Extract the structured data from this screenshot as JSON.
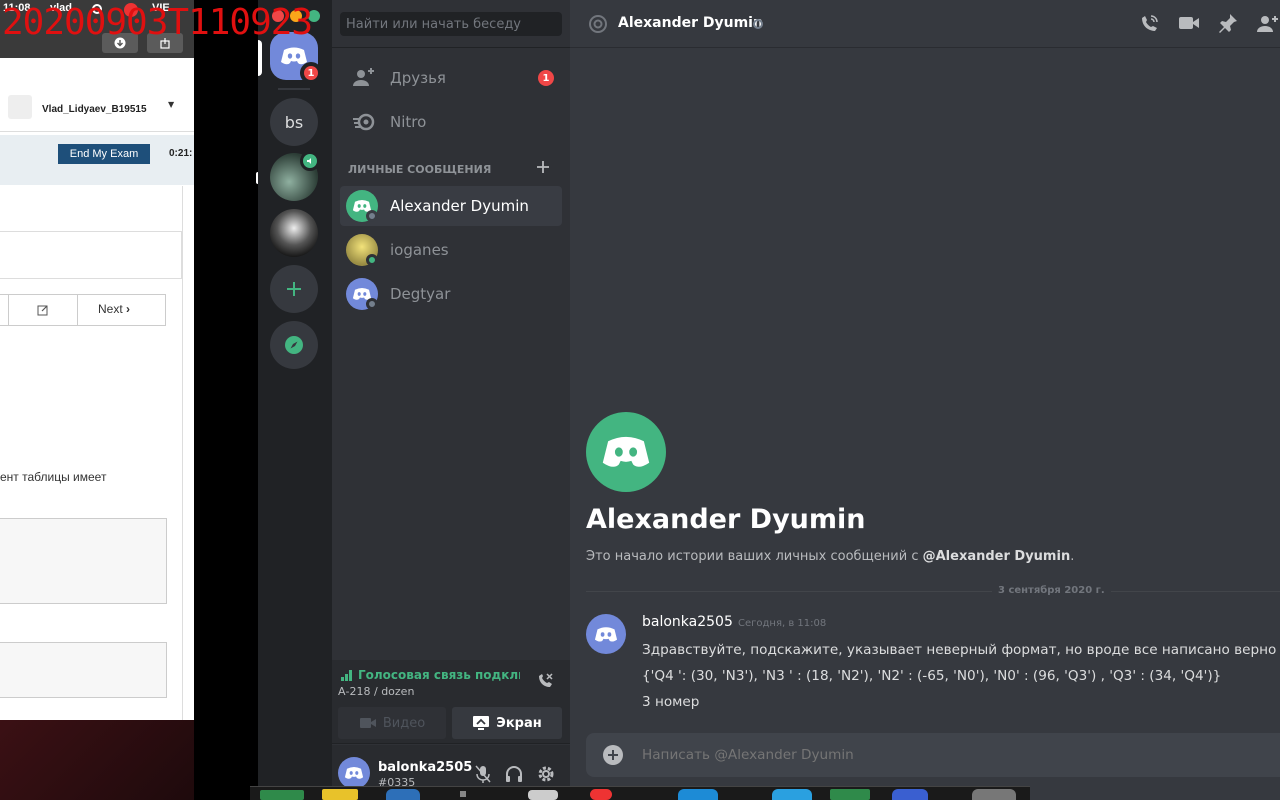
{
  "overlay": {
    "timestamp": "20200903T110923"
  },
  "exam": {
    "status_time": "11:08",
    "status_user": "vlad",
    "status_flag": "VIE",
    "username": "Vlad_Lidyaev_B19515",
    "end_button": "End My Exam",
    "timer": "0:21:",
    "next": "Next",
    "question_fragment": "ент таблицы имеет"
  },
  "discord": {
    "colors": {
      "green": "#43b581",
      "blurple": "#7289da",
      "red": "#f04747",
      "accent": "#3ba55d"
    },
    "guilds": {
      "home_badge": "1",
      "bs_label": "bs",
      "add_icon": "plus-icon",
      "explore_icon": "compass-icon"
    },
    "search_placeholder": "Найти или начать беседу",
    "nav": {
      "friends": "Друзья",
      "friends_badge": "1",
      "nitro": "Nitro"
    },
    "dm_header": "ЛИЧНЫЕ СООБЩЕНИЯ",
    "dms": [
      {
        "name": "Alexander Dyumin"
      },
      {
        "name": "ioganes"
      },
      {
        "name": "Degtyar"
      }
    ],
    "voice": {
      "status": "Голосовая связь подключена",
      "channel": "А-218 / dozen",
      "video": "Видео",
      "screen": "Экран"
    },
    "user": {
      "name": "balonka2505",
      "tag": "#0335"
    },
    "header": {
      "title": "Alexander Dyumin"
    },
    "intro": {
      "title": "Alexander Dyumin",
      "text_prefix": "Это начало истории ваших личных сообщений с ",
      "text_mention": "@Alexander Dyumin",
      "text_suffix": "."
    },
    "date_divider": "3 сентября 2020 г.",
    "message": {
      "author": "balonka2505",
      "time": "Сегодня, в 11:08",
      "lines": [
        "Здравствуйте, подскажите, указывает неверный формат, но вроде все написано верно",
        "{'Q4 ': (30, 'N3'), 'N3 ' : (18, 'N2'), 'N2' : (-65, 'N0'), 'N0' : (96, 'Q3') , 'Q3' : (34, 'Q4')}",
        "3 номер"
      ]
    },
    "composer": {
      "placeholder": "Написать @Alexander Dyumin"
    }
  }
}
